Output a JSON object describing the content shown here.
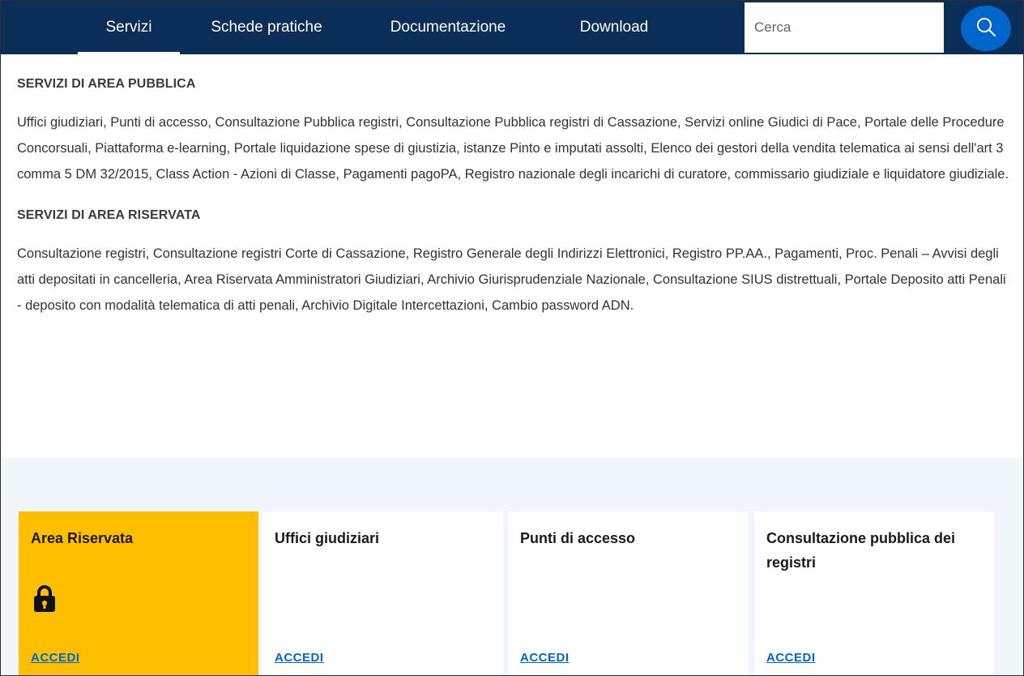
{
  "nav": {
    "items": [
      {
        "label": "Servizi",
        "active": true
      },
      {
        "label": "Schede pratiche",
        "active": false
      },
      {
        "label": "Documentazione",
        "active": false
      },
      {
        "label": "Download",
        "active": false
      }
    ],
    "search_placeholder": "Cerca",
    "search_icon": "search-icon"
  },
  "sections": {
    "public_title": "SERVIZI DI AREA PUBBLICA",
    "public_text": "Uffici giudiziari, Punti di accesso, Consultazione Pubblica registri, Consultazione Pubblica registri di Cassazione, Servizi online Giudici di Pace, Portale delle Procedure Concorsuali, Piattaforma e-learning, Portale liquidazione spese di giustizia, istanze Pinto e imputati assolti, Elenco dei gestori della vendita telematica ai sensi dell'art 3 comma 5 DM 32/2015, Class Action - Azioni di Classe, Pagamenti pagoPA, Registro nazionale degli incarichi di curatore, commissario giudiziale e liquidatore giudiziale.",
    "reserved_title": "SERVIZI DI AREA RISERVATA",
    "reserved_text": "Consultazione registri, Consultazione registri Corte di Cassazione, Registro Generale degli Indirizzi Elettronici, Registro PP.AA., Pagamenti, Proc. Penali – Avvisi degli atti depositati in cancelleria, Area Riservata Amministratori Giudiziari, Archivio Giurisprudenziale Nazionale, Consultazione SIUS distrettuali, Portale Deposito atti Penali - deposito con modalità telematica di atti penali, Archivio Digitale Intercettazioni, Cambio password ADN."
  },
  "cards": [
    {
      "title": "Area Riservata",
      "link": "ACCEDI",
      "icon": "lock-icon"
    },
    {
      "title": "Uffici giudiziari",
      "link": "ACCEDI"
    },
    {
      "title": "Punti di accesso",
      "link": "ACCEDI"
    },
    {
      "title": "Consultazione pubblica dei registri",
      "link": "ACCEDI"
    }
  ],
  "colors": {
    "nav_bg": "#0b2e59",
    "accent_blue": "#0066cc",
    "primary_card": "#ffbf00",
    "cards_bg": "#f0f6fc"
  }
}
